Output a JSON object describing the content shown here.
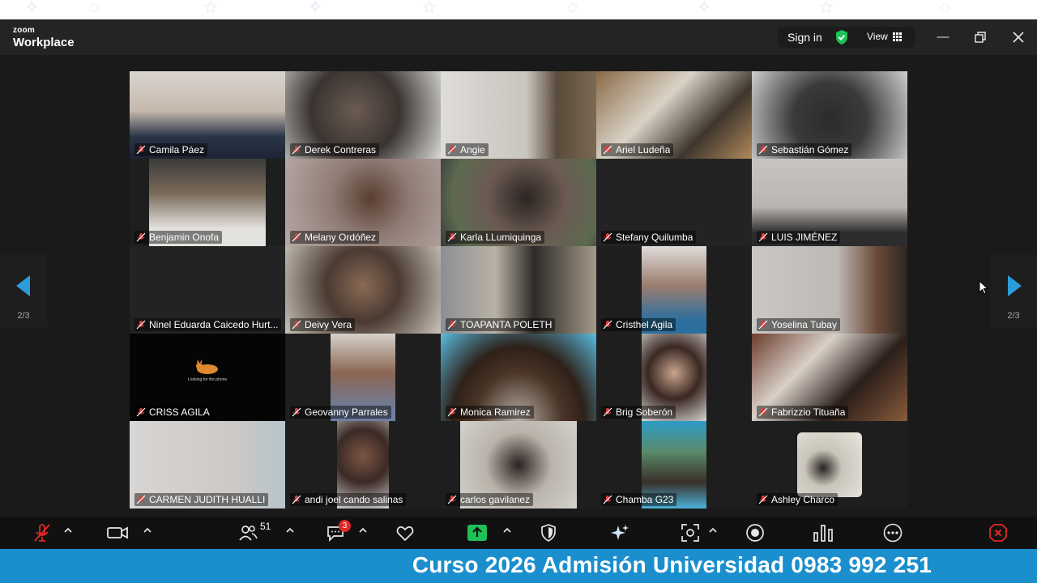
{
  "app": {
    "brand_small": "zoom",
    "brand_large": "Workplace",
    "signin_label": "Sign in",
    "view_label": "View"
  },
  "gallery": {
    "participants": [
      {
        "name": "Camila Páez"
      },
      {
        "name": "Derek Contreras"
      },
      {
        "name": "Angie"
      },
      {
        "name": "Ariel Ludeña"
      },
      {
        "name": "Sebastián Gómez"
      },
      {
        "name": "Benjamin Onofa"
      },
      {
        "name": "Melany Ordóñez"
      },
      {
        "name": "Karla LLumiquinga"
      },
      {
        "name": "Stefany Quilumba"
      },
      {
        "name": "LUIS  JIMÉNEZ"
      },
      {
        "name": "Ninel Eduarda Caicedo Hurt..."
      },
      {
        "name": "Deivy Vera"
      },
      {
        "name": "TOAPANTA POLETH"
      },
      {
        "name": "Cristhel Agila"
      },
      {
        "name": "Yoselina Tubay"
      },
      {
        "name": "CRISS AGILA",
        "screen_text": "Looking for the phone"
      },
      {
        "name": "Geovanny Parrales"
      },
      {
        "name": "Monica Ramirez"
      },
      {
        "name": "Brig Soberón"
      },
      {
        "name": "Fabrizzio Tituaña"
      },
      {
        "name": "CARMEN JUDITH HUALLI"
      },
      {
        "name": "andi joel cando salinas"
      },
      {
        "name": "carlos gavilanez"
      },
      {
        "name": "Chamba G23"
      },
      {
        "name": "Ashley Charco"
      }
    ],
    "page_indicator_left": "2/3",
    "page_indicator_right": "2/3"
  },
  "toolbar": {
    "participants_count": "51",
    "chat_badge": "3",
    "icons": [
      "mic-muted-icon",
      "video-camera-icon",
      "participants-icon",
      "chat-icon",
      "reactions-icon",
      "share-screen-icon",
      "security-icon",
      "ai-companion-icon",
      "apps-icon",
      "record-icon",
      "polls-icon",
      "more-icon",
      "end-meeting-icon"
    ]
  },
  "banner": {
    "text": "Curso 2026 Admisión Universidad 0983 992 251"
  },
  "colors": {
    "accent_blue": "#2d9cdb",
    "banner_blue": "#1b8fce",
    "share_green": "#1fc157",
    "mute_red": "#e02828"
  }
}
